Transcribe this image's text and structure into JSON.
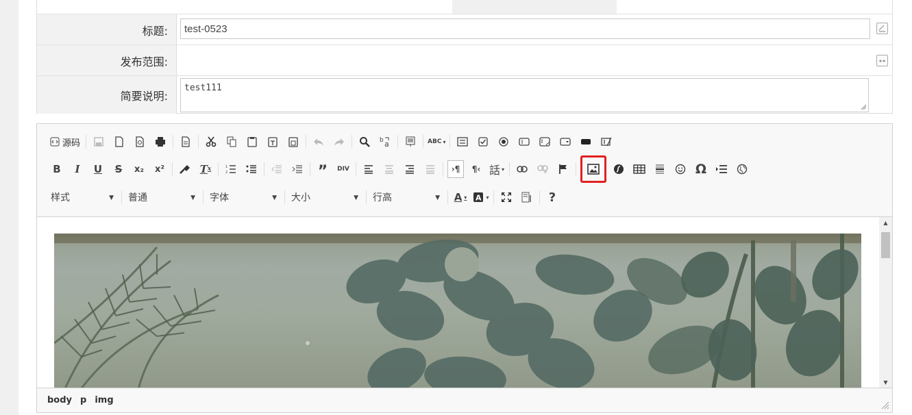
{
  "form": {
    "title_label": "标题:",
    "title_value": "test-0523",
    "scope_label": "发布范围:",
    "scope_value": "",
    "desc_label": "简要说明:",
    "desc_value": "test111"
  },
  "toolbar": {
    "source_label": "源码",
    "combos": {
      "style": "样式",
      "format": "普通",
      "font": "字体",
      "size": "大小",
      "line_height": "行高"
    },
    "icons": {
      "abc": "ABC",
      "subscript": "x₂",
      "superscript": "x²",
      "omega": "Ω",
      "help": "?",
      "words": "話"
    },
    "highlighted_button": "image-icon"
  },
  "editor": {
    "content": "image"
  },
  "statusbar": {
    "path": [
      "body",
      "p",
      "img"
    ]
  },
  "colors": {
    "highlight": "#e02020",
    "toolbar_bg": "#f8f8f8",
    "label_bg": "#f2f2f2"
  }
}
